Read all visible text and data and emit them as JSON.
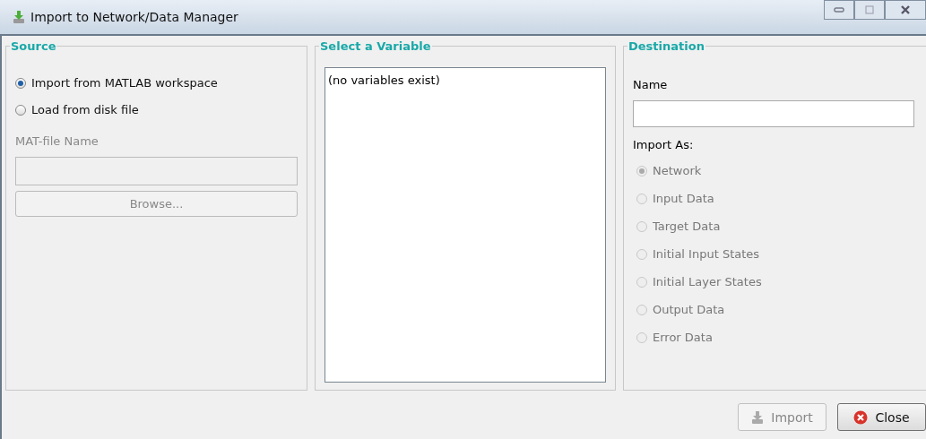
{
  "window": {
    "title": "Import to Network/Data Manager"
  },
  "source": {
    "title": "Source",
    "options": [
      {
        "label": "Import from MATLAB workspace",
        "selected": true,
        "disabled": false
      },
      {
        "label": "Load from disk file",
        "selected": false,
        "disabled": false
      }
    ],
    "file_label": "MAT-file Name",
    "file_field": {
      "disabled": true
    },
    "browse_button": {
      "label": "Browse...",
      "disabled": true
    }
  },
  "variable": {
    "title": "Select a Variable",
    "items": [
      "(no variables exist)"
    ]
  },
  "destination": {
    "title": "Destination",
    "name_label": "Name",
    "import_as_label": "Import As:",
    "options": [
      {
        "label": "Network",
        "selected": true,
        "disabled": true
      },
      {
        "label": "Input Data",
        "selected": false,
        "disabled": true
      },
      {
        "label": "Target Data",
        "selected": false,
        "disabled": true
      },
      {
        "label": "Initial Input States",
        "selected": false,
        "disabled": true
      },
      {
        "label": "Initial Layer States",
        "selected": false,
        "disabled": true
      },
      {
        "label": "Output Data",
        "selected": false,
        "disabled": true
      },
      {
        "label": "Error Data",
        "selected": false,
        "disabled": true
      }
    ]
  },
  "buttons": [
    {
      "kind": "import",
      "label": "Import",
      "disabled": true
    },
    {
      "kind": "close",
      "label": "Close",
      "disabled": false
    }
  ]
}
